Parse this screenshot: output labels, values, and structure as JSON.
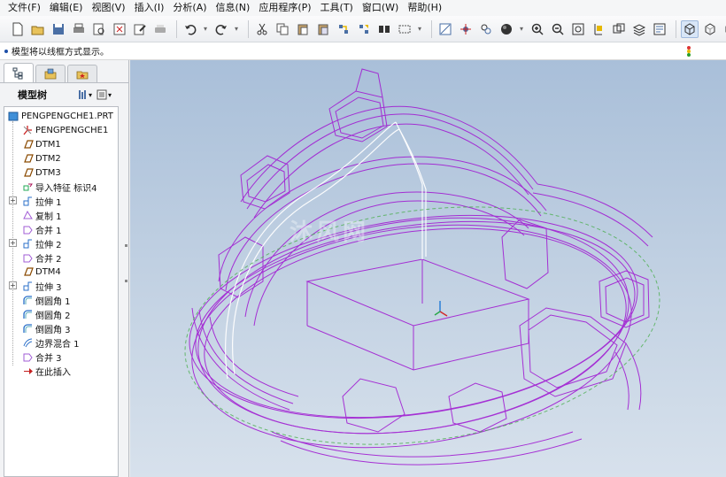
{
  "menu": [
    "文件(F)",
    "编辑(E)",
    "视图(V)",
    "插入(I)",
    "分析(A)",
    "信息(N)",
    "应用程序(P)",
    "工具(T)",
    "窗口(W)",
    "帮助(H)"
  ],
  "toolbar_icons": [
    "new-file-icon",
    "open-folder-icon",
    "save-icon",
    "print-icon",
    "print-preview-icon",
    "close-window-icon",
    "edit-icon",
    "printer-setup-icon",
    "undo-icon",
    "redo-icon",
    "cut-icon",
    "copy-icon",
    "paste-icon",
    "paste-special-icon",
    "regenerate-icon",
    "regen-manager-icon",
    "find-icon",
    "select-box-icon",
    "datum-display-icon",
    "spin-center-icon",
    "orient-mode-icon",
    "shading-icon",
    "zoom-in-icon",
    "zoom-out-icon",
    "refit-icon",
    "reorient-icon",
    "saved-views-icon",
    "layers-icon",
    "view-manager-icon",
    "wireframe-icon",
    "hidden-line-icon",
    "no-hidden-icon",
    "shaded-icon"
  ],
  "message": "模型将以线框方式显示。",
  "sidebar": {
    "tabs": [
      "model-tree-tab-icon",
      "folder-browser-tab-icon",
      "favorites-tab-icon"
    ],
    "header_title": "模型树"
  },
  "tree": [
    {
      "label": "PENGPENGCHE1.PRT",
      "icon": "part-icon",
      "expander": false
    },
    {
      "label": "PENGPENGCHE1",
      "icon": "csys-icon",
      "expander": false
    },
    {
      "label": "DTM1",
      "icon": "datum-plane-icon",
      "expander": false
    },
    {
      "label": "DTM2",
      "icon": "datum-plane-icon",
      "expander": false
    },
    {
      "label": "DTM3",
      "icon": "datum-plane-icon",
      "expander": false
    },
    {
      "label": "导入特征 标识4",
      "icon": "import-feature-icon",
      "expander": false
    },
    {
      "label": "拉伸 1",
      "icon": "extrude-icon",
      "expander": true
    },
    {
      "label": "复制 1",
      "icon": "copy-feature-icon",
      "expander": false
    },
    {
      "label": "合并 1",
      "icon": "merge-icon",
      "expander": false
    },
    {
      "label": "拉伸 2",
      "icon": "extrude-icon",
      "expander": true
    },
    {
      "label": "合并 2",
      "icon": "merge-icon",
      "expander": false
    },
    {
      "label": "DTM4",
      "icon": "datum-plane-icon",
      "expander": false
    },
    {
      "label": "拉伸 3",
      "icon": "extrude-icon",
      "expander": true
    },
    {
      "label": "倒圆角 1",
      "icon": "round-icon",
      "expander": false
    },
    {
      "label": "倒圆角 2",
      "icon": "round-icon",
      "expander": false
    },
    {
      "label": "倒圆角 3",
      "icon": "round-icon",
      "expander": false
    },
    {
      "label": "边界混合 1",
      "icon": "boundary-blend-icon",
      "expander": false
    },
    {
      "label": "合并 3",
      "icon": "merge-icon",
      "expander": false
    },
    {
      "label": "在此插入",
      "icon": "insert-here-icon",
      "expander": false
    }
  ],
  "watermark": "沐风网",
  "colors": {
    "wire": "#a11ed2",
    "highlight": "#ffffff",
    "datum": "#4caf50"
  }
}
